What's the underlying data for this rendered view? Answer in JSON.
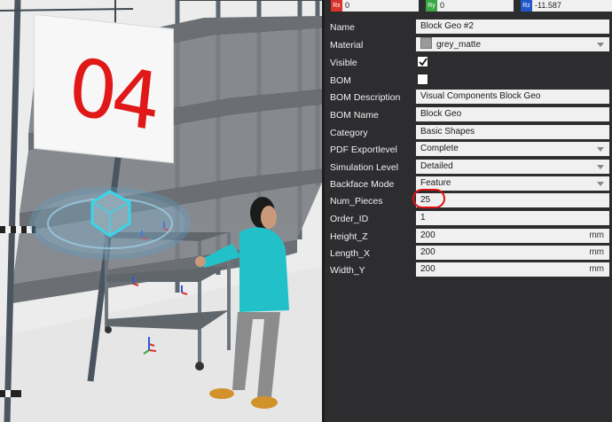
{
  "viewport": {
    "sign_text": "04"
  },
  "rotation": {
    "rx": {
      "tag": "Rx",
      "value": "0",
      "color": "#d9342b"
    },
    "ry": {
      "tag": "Ry",
      "value": "0",
      "color": "#3aa843"
    },
    "rz": {
      "tag": "Rz",
      "value": "-11.587",
      "color": "#2257c9"
    }
  },
  "properties": {
    "name": {
      "label": "Name",
      "value": "Block Geo #2"
    },
    "material": {
      "label": "Material",
      "value": "grey_matte"
    },
    "visible": {
      "label": "Visible",
      "checked": true
    },
    "bom": {
      "label": "BOM",
      "checked": false
    },
    "bom_description": {
      "label": "BOM Description",
      "value": "Visual Components Block Geo"
    },
    "bom_name": {
      "label": "BOM Name",
      "value": "Block Geo"
    },
    "category": {
      "label": "Category",
      "value": "Basic Shapes"
    },
    "pdf_exportlevel": {
      "label": "PDF Exportlevel",
      "value": "Complete"
    },
    "simulation_level": {
      "label": "Simulation Level",
      "value": "Detailed"
    },
    "backface_mode": {
      "label": "Backface Mode",
      "value": "Feature"
    },
    "num_pieces": {
      "label": "Num_Pieces",
      "value": "25"
    },
    "order_id": {
      "label": "Order_ID",
      "value": "1"
    },
    "height_z": {
      "label": "Height_Z",
      "value": "200",
      "unit": "mm"
    },
    "length_x": {
      "label": "Length_X",
      "value": "200",
      "unit": "mm"
    },
    "width_y": {
      "label": "Width_Y",
      "value": "200",
      "unit": "mm"
    }
  }
}
